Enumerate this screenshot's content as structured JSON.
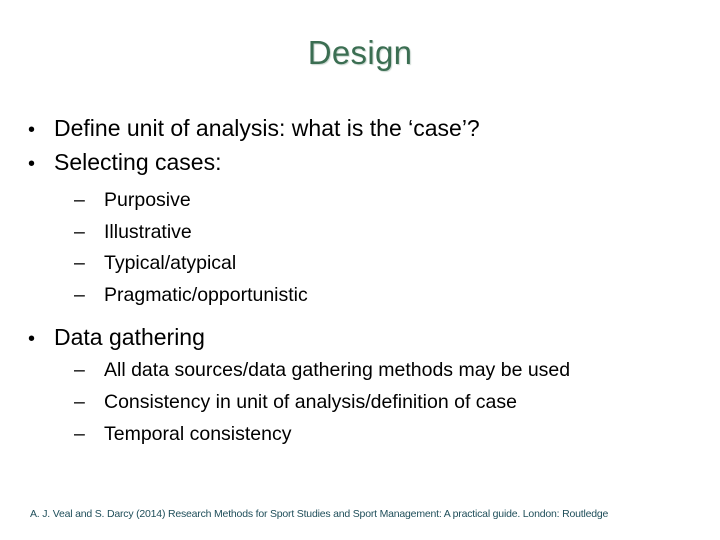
{
  "slide": {
    "title": "Design",
    "bullets": [
      {
        "text": "Define unit of analysis: what is the ‘case’?",
        "marker": "•"
      },
      {
        "text": "Selecting cases:",
        "marker": "•",
        "subitems": [
          {
            "text": "Purposive",
            "marker": "–"
          },
          {
            "text": "Illustrative",
            "marker": "–"
          },
          {
            "text": "Typical/atypical",
            "marker": "–"
          },
          {
            "text": "Pragmatic/opportunistic",
            "marker": "–"
          }
        ]
      },
      {
        "text": "Data gathering",
        "marker": "•",
        "subitems": [
          {
            "text": "All data sources/data gathering methods may be used",
            "marker": "–"
          },
          {
            "text": "Consistency in unit of analysis/definition of case",
            "marker": "–"
          },
          {
            "text": "Temporal consistency",
            "marker": "–"
          }
        ]
      }
    ],
    "footer": "A. J. Veal and S. Darcy (2014) Research Methods for Sport Studies and Sport Management: A practical guide. London: Routledge"
  },
  "colors": {
    "title": "#3b6e52",
    "footer": "#1f4e5a"
  }
}
